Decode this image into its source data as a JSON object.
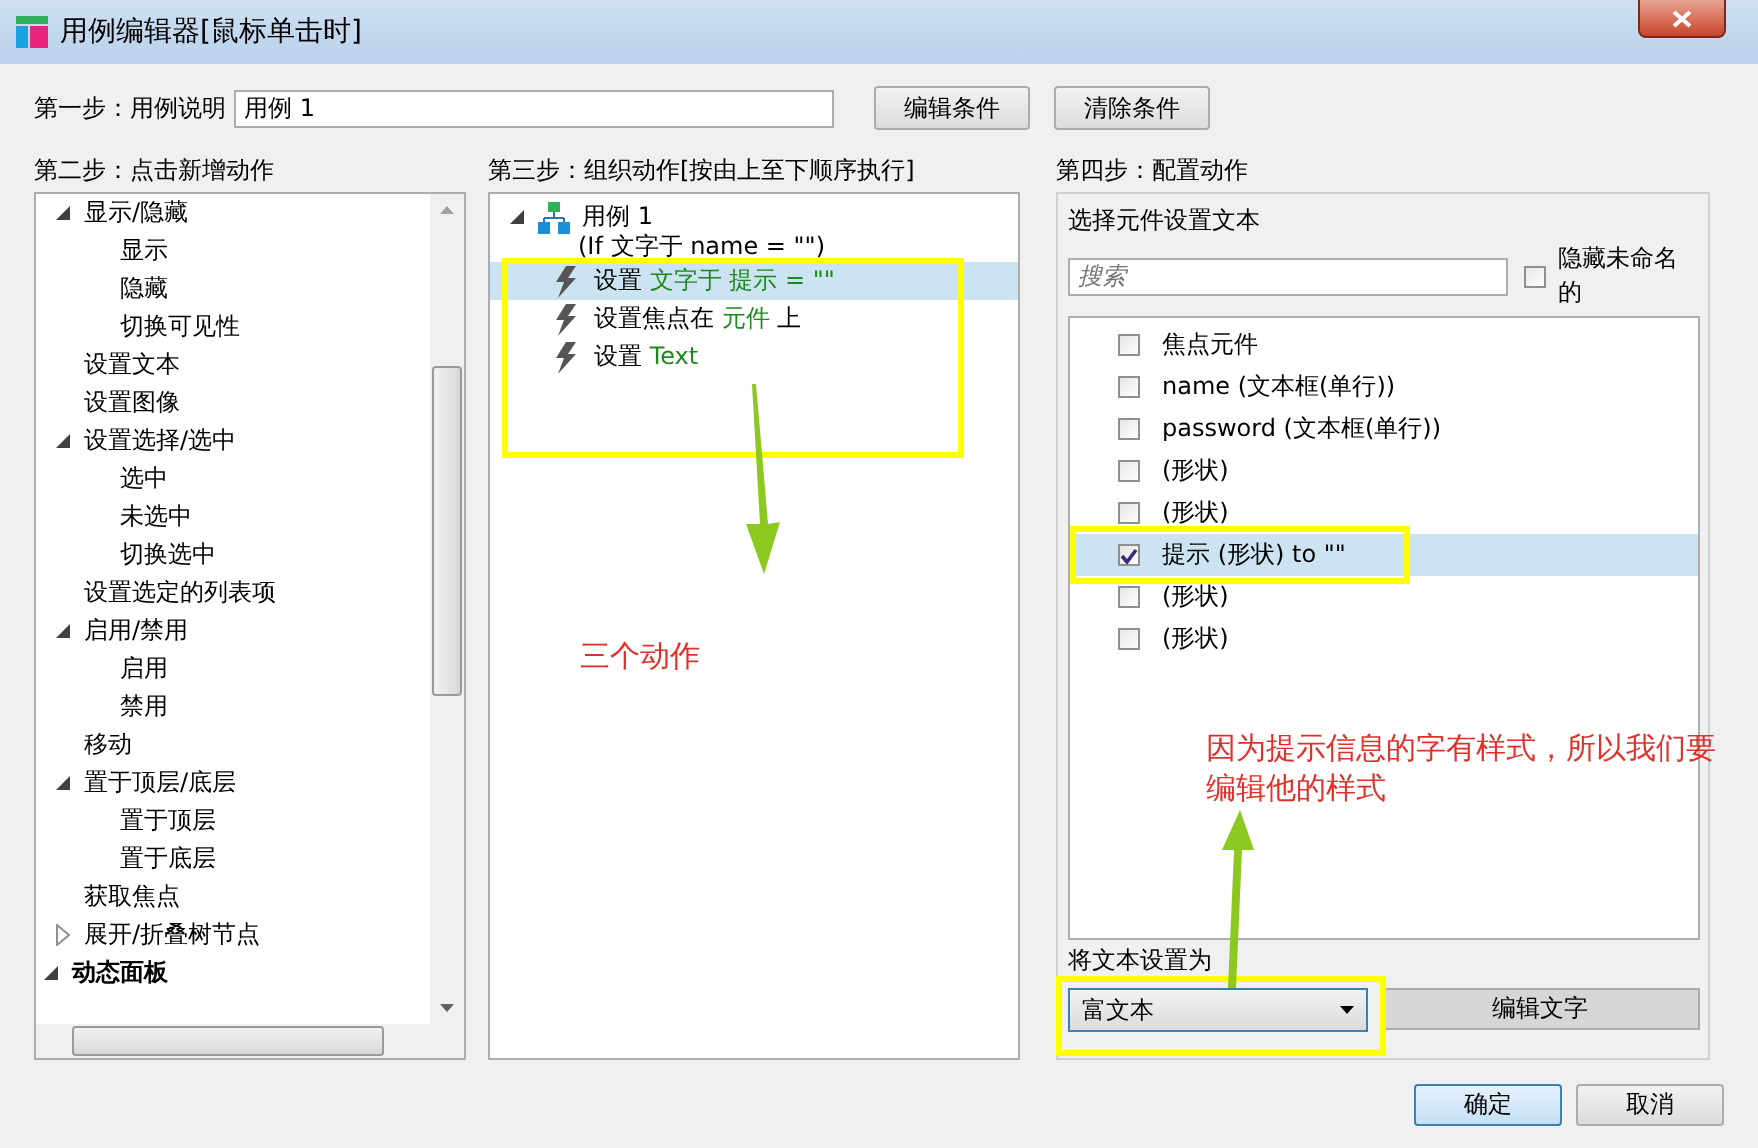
{
  "window": {
    "title": "用例编辑器[鼠标单击时]"
  },
  "step1": {
    "label": "第一步：用例说明",
    "value": "用例 1",
    "buttons": [
      "编辑条件",
      "清除条件"
    ]
  },
  "step2": {
    "heading": "第二步：点击新增动作",
    "tree": [
      {
        "children": [
          {
            "label": "显示/隐藏",
            "expanded": true,
            "children": [
              {
                "label": "显示"
              },
              {
                "label": "隐藏"
              },
              {
                "label": "切换可见性"
              }
            ]
          },
          {
            "label": "设置文本"
          },
          {
            "label": "设置图像"
          },
          {
            "label": "设置选择/选中",
            "expanded": true,
            "children": [
              {
                "label": "选中"
              },
              {
                "label": "未选中"
              },
              {
                "label": "切换选中"
              }
            ]
          },
          {
            "label": "设置选定的列表项"
          },
          {
            "label": "启用/禁用",
            "expanded": true,
            "children": [
              {
                "label": "启用"
              },
              {
                "label": "禁用"
              }
            ]
          },
          {
            "label": "移动"
          },
          {
            "label": "置于顶层/底层",
            "expanded": true,
            "children": [
              {
                "label": "置于顶层"
              },
              {
                "label": "置于底层"
              }
            ]
          },
          {
            "label": "获取焦点"
          },
          {
            "label": "展开/折叠树节点",
            "expanded": false
          }
        ]
      },
      {
        "label": "动态面板",
        "expanded": true,
        "bold": true
      }
    ]
  },
  "step3": {
    "heading": "第三步：组织动作[按由上至下顺序执行]",
    "case": {
      "label": "用例 1",
      "expanded": true,
      "condition": "(If 文字于 name = \"\")",
      "actions": [
        {
          "selected": true,
          "parts": [
            {
              "kind": "plain",
              "text": "设置 "
            },
            {
              "kind": "value",
              "text": "文字于 提示 = \"\""
            }
          ]
        },
        {
          "selected": false,
          "parts": [
            {
              "kind": "plain",
              "text": "设置焦点在 "
            },
            {
              "kind": "value",
              "text": "元件"
            },
            {
              "kind": "plain",
              "text": " 上"
            }
          ]
        },
        {
          "selected": false,
          "parts": [
            {
              "kind": "plain",
              "text": "设置 "
            },
            {
              "kind": "value",
              "text": "Text"
            }
          ]
        }
      ]
    }
  },
  "step4": {
    "heading": "第四步：配置动作",
    "subheading": "选择元件设置文本",
    "search": {
      "placeholder": "搜索"
    },
    "hide_unnamed": {
      "label": "隐藏未命名的",
      "checked": false
    },
    "widgets": [
      {
        "label": "焦点元件",
        "checked": false,
        "selected": false
      },
      {
        "label": "name (文本框(单行))",
        "checked": false,
        "selected": false
      },
      {
        "label": "password (文本框(单行))",
        "checked": false,
        "selected": false
      },
      {
        "label": "(形状)",
        "checked": false,
        "selected": false
      },
      {
        "label": "(形状)",
        "checked": false,
        "selected": false
      },
      {
        "label": "提示 (形状) to \"\"",
        "checked": true,
        "selected": true
      },
      {
        "label": "(形状)",
        "checked": false,
        "selected": false
      },
      {
        "label": "(形状)",
        "checked": false,
        "selected": false
      }
    ],
    "set_as_label": "将文本设置为",
    "set_as_value": "富文本",
    "edit_button": "编辑文字"
  },
  "buttons": [
    "确定",
    "取消"
  ],
  "annotations": [
    {
      "text": "三个动作"
    },
    {
      "text": "因为提示信息的字有样式，所以我们要编辑他的样式"
    }
  ]
}
